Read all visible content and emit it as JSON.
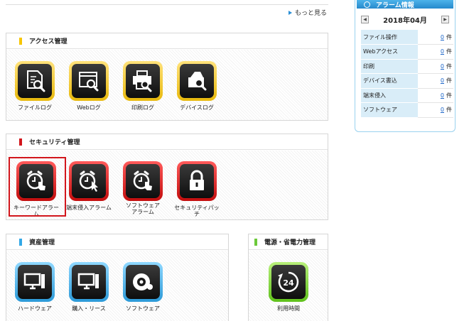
{
  "more_link": "もっと見る",
  "access": {
    "title": "アクセス管理",
    "items": [
      "ファイルログ",
      "Webログ",
      "印刷ログ",
      "デバイスログ"
    ]
  },
  "security": {
    "title": "セキュリティ管理",
    "items": [
      "キーワードアラーム",
      "端末侵入アラーム",
      "ソフトウェア\nアラーム",
      "セキュリティパッチ"
    ]
  },
  "assets": {
    "title": "資産管理",
    "items": [
      "ハードウェア",
      "購入・リース",
      "ソフトウェア"
    ]
  },
  "power": {
    "title": "電源・省電力管理",
    "items": [
      "利用時間"
    ],
    "icon_text": "24"
  },
  "alarm": {
    "title": "アラーム情報",
    "month": "2018年04月",
    "prev": "◀",
    "next": "▶",
    "unit": "件",
    "rows": [
      {
        "name": "ファイル操作",
        "count": "0"
      },
      {
        "name": "Webアクセス",
        "count": "0"
      },
      {
        "name": "印刷",
        "count": "0"
      },
      {
        "name": "デバイス書込",
        "count": "0"
      },
      {
        "name": "端末侵入",
        "count": "0"
      },
      {
        "name": "ソフトウェア",
        "count": "0"
      }
    ]
  },
  "colors": {
    "access": "#f7c600",
    "security": "#d2161c",
    "assets": "#33a8e6",
    "power": "#6cc93a",
    "accent": "#2a8fd6"
  }
}
